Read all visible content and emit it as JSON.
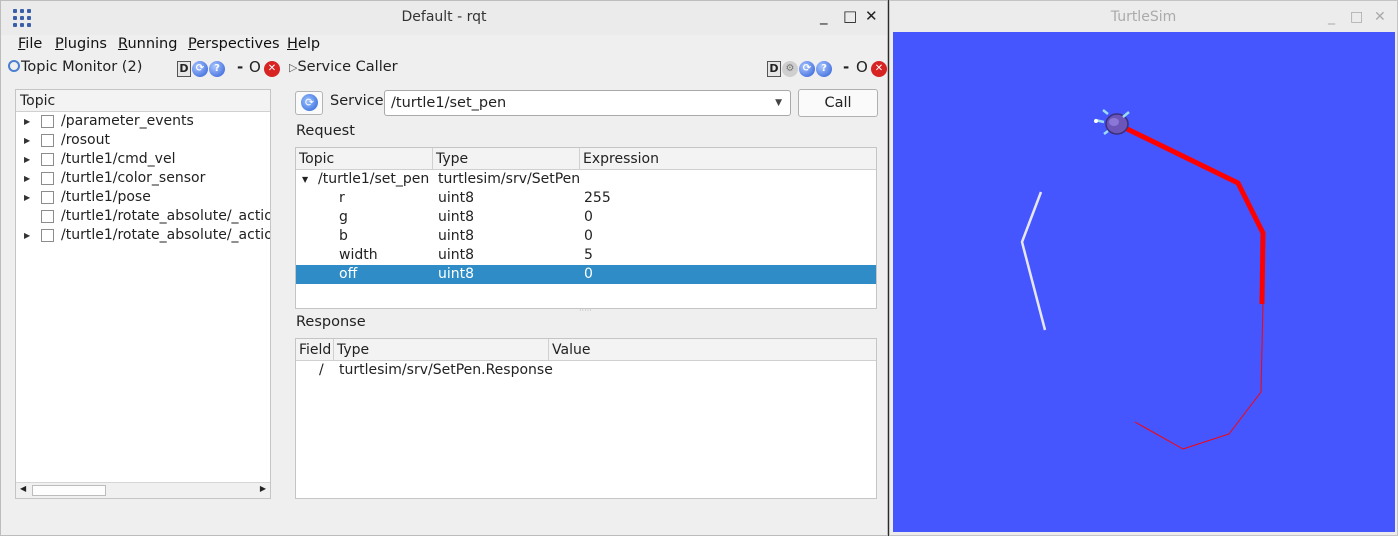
{
  "rqt": {
    "title": "Default - rqt",
    "controls": {
      "minimize": "_",
      "maximize": "□",
      "close": "✕"
    },
    "menu": [
      "File",
      "Plugins",
      "Running",
      "Perspectives",
      "Help"
    ],
    "menu_mnemonics": [
      "F",
      "P",
      "R",
      "P",
      "H"
    ]
  },
  "topic_monitor": {
    "title": "Topic Monitor (2)",
    "badge": "D",
    "dock_sep": "-",
    "dock_o": "O",
    "column": "Topic",
    "topics": [
      {
        "name": "/parameter_events",
        "expandable": true
      },
      {
        "name": "/rosout",
        "expandable": true
      },
      {
        "name": "/turtle1/cmd_vel",
        "expandable": true
      },
      {
        "name": "/turtle1/color_sensor",
        "expandable": true
      },
      {
        "name": "/turtle1/pose",
        "expandable": true
      },
      {
        "name": "/turtle1/rotate_absolute/_actio",
        "expandable": false
      },
      {
        "name": "/turtle1/rotate_absolute/_actio",
        "expandable": true
      }
    ]
  },
  "service_caller": {
    "title": "Service Caller",
    "badge": "D",
    "dock_sep": "-",
    "dock_o": "O",
    "service_label": "Service",
    "service_value": "/turtle1/set_pen",
    "call_label": "Call",
    "request_label": "Request",
    "request_columns": [
      "Topic",
      "Type",
      "Expression"
    ],
    "request_root": {
      "topic": "/turtle1/set_pen",
      "type": "turtlesim/srv/SetPen"
    },
    "request_rows": [
      {
        "topic": "r",
        "type": "uint8",
        "expr": "255"
      },
      {
        "topic": "g",
        "type": "uint8",
        "expr": "0"
      },
      {
        "topic": "b",
        "type": "uint8",
        "expr": "0"
      },
      {
        "topic": "width",
        "type": "uint8",
        "expr": "5"
      },
      {
        "topic": "off",
        "type": "uint8",
        "expr": "0"
      }
    ],
    "response_label": "Response",
    "response_columns": [
      "Field",
      "Type",
      "Value"
    ],
    "response_rows": [
      {
        "field": "/",
        "type": "turtlesim/srv/SetPen.Response",
        "value": ""
      }
    ]
  },
  "turtlesim": {
    "title": "TurtleSim",
    "controls": {
      "minimize": "_",
      "maximize": "□",
      "close": "✕"
    },
    "background": "#4556ff"
  },
  "colors": {
    "selection": "#308cc6",
    "close_red": "#d82323",
    "pen_red": "#ff0000"
  }
}
